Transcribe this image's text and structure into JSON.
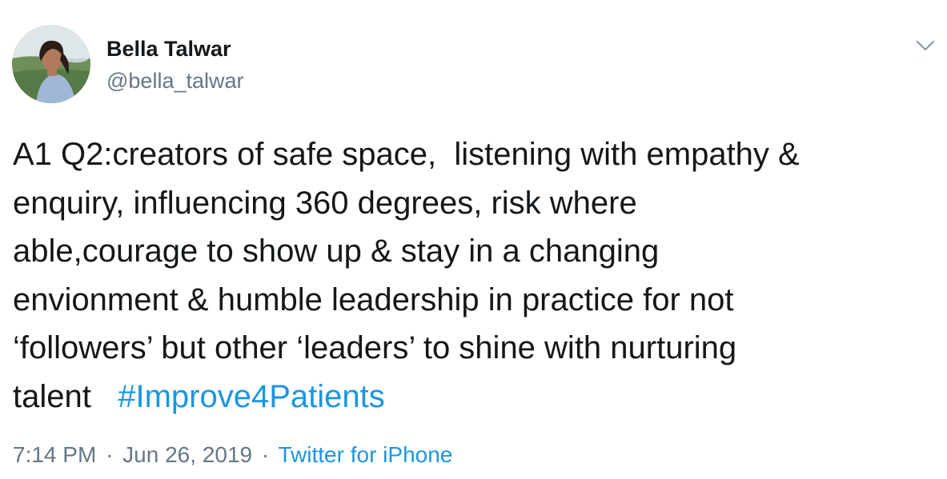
{
  "author": {
    "display_name": "Bella Talwar",
    "handle": "@bella_talwar"
  },
  "header": {
    "menu_icon": "chevron-down-icon"
  },
  "tweet": {
    "line1": "A1 Q2:creators of safe space,  listening with empathy &",
    "line2": "enquiry, influencing 360 degrees, risk where",
    "line3": "able,courage to show up & stay in a changing",
    "line4": "envionment & humble leadership in practice for not",
    "line5": "‘followers’ but other ‘leaders’ to shine with nurturing",
    "line6_text": "talent   ",
    "hashtag": "#Improve4Patients"
  },
  "meta": {
    "time": "7:14 PM",
    "separator": "·",
    "date": "Jun 26, 2019",
    "source": "Twitter for iPhone"
  },
  "colors": {
    "text": "#14171a",
    "secondary": "#657786",
    "link": "#1b95e0"
  }
}
